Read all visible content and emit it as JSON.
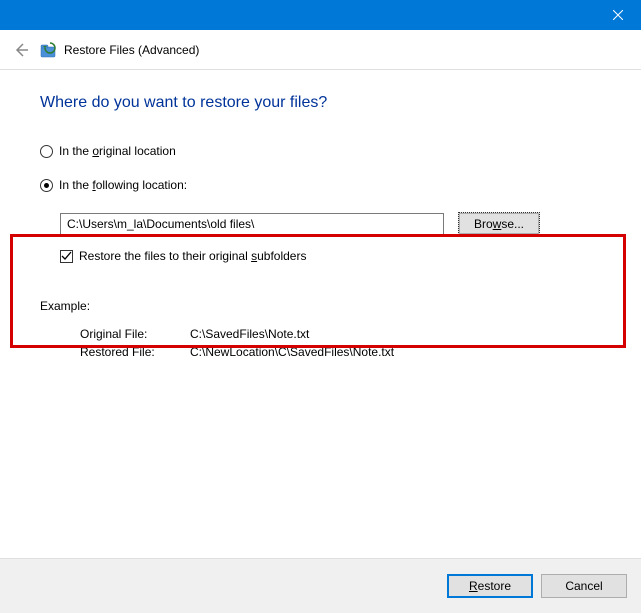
{
  "window": {
    "title": "Restore Files (Advanced)"
  },
  "heading": "Where do you want to restore your files?",
  "options": {
    "original": {
      "label_pre": "In the ",
      "accel": "o",
      "label_post": "riginal location",
      "selected": false
    },
    "following": {
      "label_pre": "In the ",
      "accel": "f",
      "label_post": "ollowing location:",
      "selected": true,
      "path": "C:\\Users\\m_la\\Documents\\old files\\",
      "browse_pre": "Bro",
      "browse_accel": "w",
      "browse_post": "se...",
      "restore_sub_pre": "Restore the files to their original ",
      "restore_sub_accel": "s",
      "restore_sub_post": "ubfolders",
      "restore_sub_checked": true
    }
  },
  "example": {
    "label": "Example:",
    "rows": [
      {
        "k": "Original File:",
        "v": "C:\\SavedFiles\\Note.txt"
      },
      {
        "k": "Restored File:",
        "v": "C:\\NewLocation\\C\\SavedFiles\\Note.txt"
      }
    ]
  },
  "footer": {
    "restore_accel": "R",
    "restore_post": "estore",
    "cancel": "Cancel"
  }
}
